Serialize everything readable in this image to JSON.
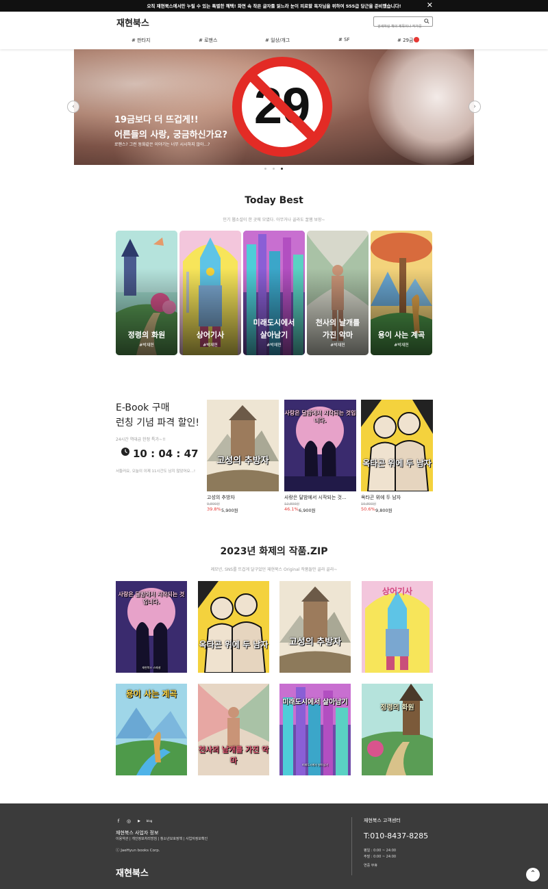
{
  "topbar": {
    "message": "오직 재현북스에서만 누릴 수 있는 특별한 혜택! 화면 속 작은 글자를 읽느라 눈이 피로할 독자님을 위하여 SSS급 당근을 준비했습니다!",
    "close_icon": "close-icon"
  },
  "header": {
    "logo": "재현북스",
    "search_placeholder": "검색하실 책의 제목이나 작가를 입력하세요",
    "nav": [
      "# 판타지",
      "# 로맨스",
      "# 일상/개그",
      "# SF",
      "# 29금"
    ]
  },
  "hero": {
    "headline_1": "19금보다 더 뜨겁게!!",
    "headline_2": "어른들의 사랑, 궁금하신가요?",
    "subtext": "로맨스? 그런 동화같은 이야기는 너무 시시하지 않아...?",
    "sign_number": "29",
    "prev": "‹",
    "next": "›",
    "slides": 3,
    "active_slide": 3
  },
  "today_best": {
    "title": "Today Best",
    "subtitle": "인기 웹소설이 한 곳에 모였다. 아무거나 골라도 꿀잼 보장~",
    "items": [
      {
        "title_lines": [
          "정령의 화원"
        ],
        "author": "#박재현"
      },
      {
        "title_lines": [
          "상어기사"
        ],
        "author": "#박재현"
      },
      {
        "title_lines": [
          "미래도시에서",
          "살아남기"
        ],
        "author": "#박재현"
      },
      {
        "title_lines": [
          "천사의 날개를",
          "가진 악마"
        ],
        "author": "#박재현"
      },
      {
        "title_lines": [
          "용이 사는 계곡"
        ],
        "author": "#박재현"
      }
    ]
  },
  "ebook": {
    "heading_1": "E-Book 구매",
    "heading_2": "런칭 기념 파격 할인!",
    "subtitle": "24시간 역대급 한정 특가~!!",
    "timer": "10 : 04 : 47",
    "note": "서둘러요, 오늘이 이제 11시간도 남지 않았어요...!",
    "items": [
      {
        "name": "고성의 추방자",
        "cover_text": "고성의 추방자",
        "original": "9,800원",
        "discount": "39.8%",
        "price": "5,900원"
      },
      {
        "name": "사랑은 달밤에서 시작되는 것...",
        "cover_text": "사랑은 달밤에서 시작되는 것입니다.",
        "original": "12,800원",
        "discount": "46.1%",
        "price": "6,900원"
      },
      {
        "name": "옥타곤 위에 두 남자",
        "cover_text": "옥타곤 위에 두 남자",
        "original": "19,800원",
        "discount": "50.6%",
        "price": "9,800원"
      }
    ]
  },
  "hot": {
    "title": "2023년 화제의 작품.ZIP",
    "subtitle": "제모년, SNS를 뜨겁게 달구었던 재현북스 Original 작품들만 골라 골라~",
    "items": [
      {
        "cover_text": "사랑은 달밤에서 시작되는 것입니다.",
        "tag": "재현북스 스페셜"
      },
      {
        "cover_text": "옥타곤 위에 두 남자",
        "tag": "재현북스 스페셜"
      },
      {
        "cover_text": "고성의 추방자",
        "tag": "재현북스 스페셜"
      },
      {
        "cover_text": "상어기사",
        "tag": "재현북스 스페셜"
      },
      {
        "cover_text": "용이 사는 계곡",
        "tag": "재현북스 스페셜"
      },
      {
        "cover_text": "천사의 날개를 가진 악마",
        "tag": "재현북스 스페셜"
      },
      {
        "cover_text": "미래도시에서 살아남기",
        "tag": "미래도시에서 살아남기"
      },
      {
        "cover_text": "정령의 화원",
        "tag": "재현북스 스페셜"
      }
    ]
  },
  "footer": {
    "sns": [
      "facebook-icon",
      "instagram-icon",
      "youtube-icon",
      "blog-icon"
    ],
    "sns_glyphs": [
      "f",
      "◎",
      "▶",
      "blog"
    ],
    "biz_title": "재현북스 사업자 정보",
    "links": "이용약관 | 개인정보처리방침 | 청소년보호정책 | 사업자정보확인",
    "copyright": "ⓒ JaeHyun books Corp.",
    "logo": "재현북스",
    "cs_title": "재현북스 고객센터",
    "phone": "T:010-8437-8285",
    "hours_weekday": "평일 : 0:00 ~ 24:00",
    "hours_weekend": "주말 : 0:00 ~ 24:00",
    "holiday": "연중 무휴",
    "to_top": "⌃"
  },
  "colors": {
    "accent_red": "#e53935",
    "footer_bg": "#3b3b3b",
    "topbar_bg": "#111111"
  }
}
